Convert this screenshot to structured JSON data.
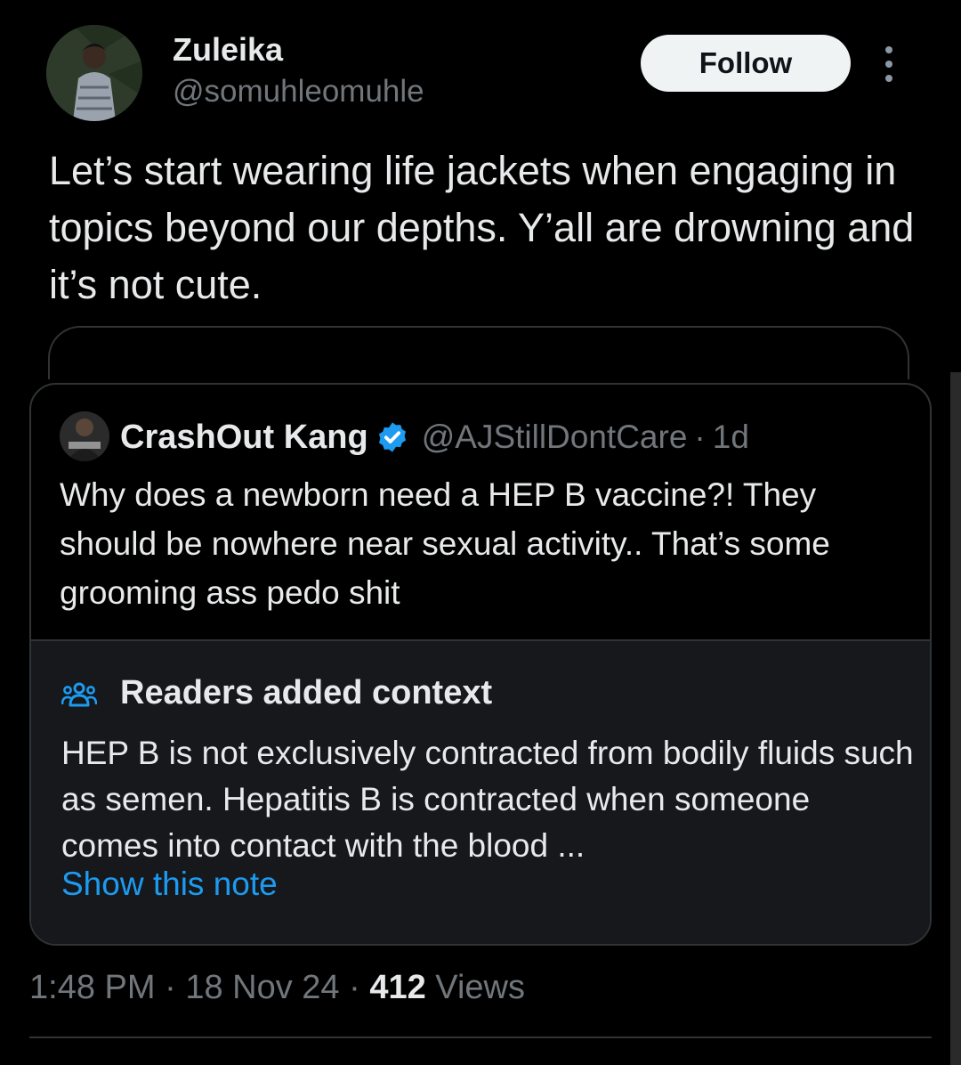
{
  "author": {
    "display_name": "Zuleika",
    "handle": "@somuhleomuhle"
  },
  "actions": {
    "follow_label": "Follow",
    "more_icon": "more-vertical-icon"
  },
  "tweet": {
    "text": "Let’s start wearing life jackets when engaging in topics beyond our depths. Y’all are drowning and it’s not cute."
  },
  "quoted_tweet": {
    "display_name": "CrashOut Kang",
    "verified_icon": "verified-badge-icon",
    "handle": "@AJStillDontCare",
    "separator": "·",
    "time": "1d",
    "text": "Why does a newborn need a HEP B vaccine?! They should be nowhere near sexual activity.. That’s some grooming ass pedo shit"
  },
  "community_note": {
    "icon": "people-icon",
    "title": "Readers added context",
    "text": "HEP B is not exclusively contracted from bodily fluids such as semen. Hepatitis B is contracted when someone comes into contact with the blood ...",
    "link_label": "Show this note"
  },
  "meta": {
    "time": "1:48 PM",
    "sep1": " · ",
    "date": "18 Nov 24",
    "sep2": " · ",
    "views_count": "412",
    "views_label": " Views"
  },
  "colors": {
    "background": "#000000",
    "text_primary": "#e7e9ea",
    "text_secondary": "#71767b",
    "link": "#1d9bf0",
    "border": "#2f3336",
    "note_panel": "#16181c",
    "verified": "#1d9bf0"
  }
}
